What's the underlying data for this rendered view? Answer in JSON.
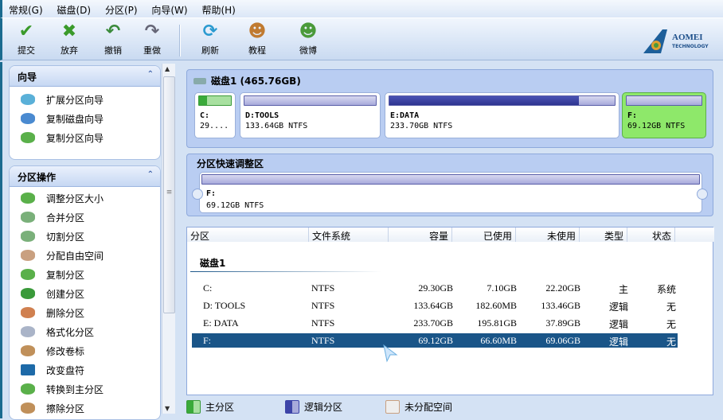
{
  "menu": [
    "常规(G)",
    "磁盘(D)",
    "分区(P)",
    "向导(W)",
    "帮助(H)"
  ],
  "toolbar": {
    "commit": "提交",
    "discard": "放弃",
    "undo": "撤销",
    "redo": "重做",
    "refresh": "刷新",
    "tutorial": "教程",
    "weibo": "微博"
  },
  "logo": {
    "brand": "AOMEI",
    "sub": "TECHNOLOGY"
  },
  "wizard": {
    "title": "向导",
    "items": [
      "扩展分区向导",
      "复制磁盘向导",
      "复制分区向导"
    ]
  },
  "ops": {
    "title": "分区操作",
    "items": [
      "调整分区大小",
      "合并分区",
      "切割分区",
      "分配自由空间",
      "复制分区",
      "创建分区",
      "删除分区",
      "格式化分区",
      "修改卷标",
      "改变盘符",
      "转换到主分区",
      "擦除分区"
    ]
  },
  "disk": {
    "title": "磁盘1 (465.76GB)",
    "partitions": [
      {
        "name": "C:",
        "info": "29....",
        "used_fraction": 0.24
      },
      {
        "name": "D:TOOLS",
        "info": "133.64GB NTFS",
        "used_fraction": 0.0
      },
      {
        "name": "E:DATA",
        "info": "233.70GB NTFS",
        "used_fraction": 0.84
      },
      {
        "name": "F:",
        "info": "69.12GB NTFS",
        "used_fraction": 0.0
      }
    ]
  },
  "quick": {
    "title": "分区快速调整区",
    "name": "F:",
    "info": "69.12GB NTFS"
  },
  "table": {
    "headers": [
      "分区",
      "文件系统",
      "容量",
      "已使用",
      "未使用",
      "类型",
      "状态"
    ],
    "group": "磁盘1",
    "rows": [
      [
        "C:",
        "NTFS",
        "29.30GB",
        "7.10GB",
        "22.20GB",
        "主",
        "系统"
      ],
      [
        "D: TOOLS",
        "NTFS",
        "133.64GB",
        "182.60MB",
        "133.46GB",
        "逻辑",
        "无"
      ],
      [
        "E: DATA",
        "NTFS",
        "233.70GB",
        "195.81GB",
        "37.89GB",
        "逻辑",
        "无"
      ],
      [
        "F:",
        "NTFS",
        "69.12GB",
        "66.60MB",
        "69.06GB",
        "逻辑",
        "无"
      ]
    ]
  },
  "legend": {
    "primary": "主分区",
    "logical": "逻辑分区",
    "unallocated": "未分配空间"
  },
  "colors": {
    "selected": "#1a5588",
    "primary": "#4cc24a",
    "logical": "#3d44a8"
  }
}
